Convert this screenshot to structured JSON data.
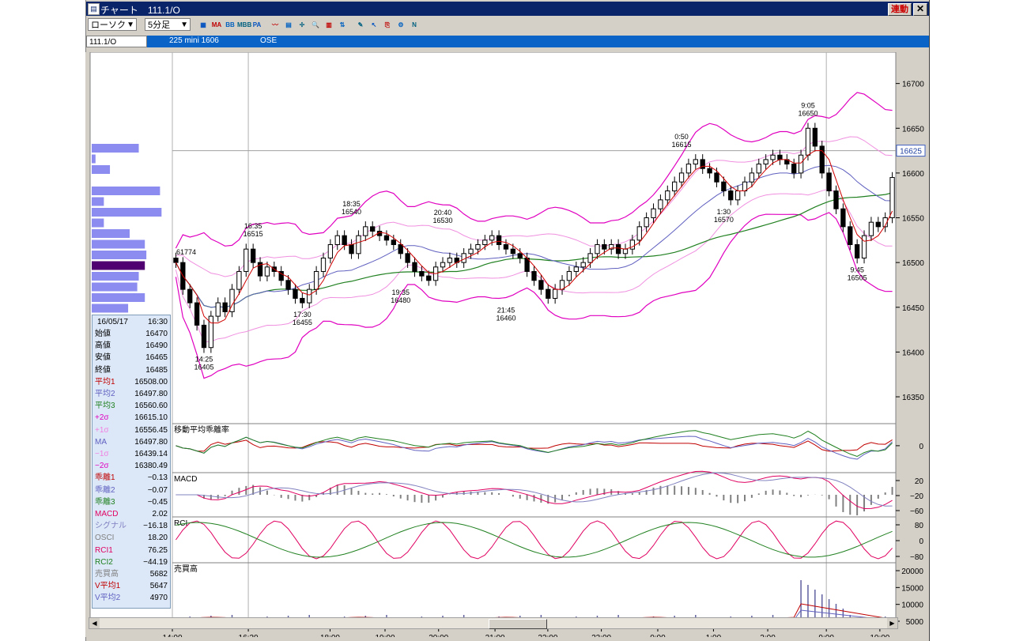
{
  "window": {
    "title": "チャート　111.1/O",
    "link_label": "連動",
    "close_label": "✕"
  },
  "toolbar": {
    "chart_type": "ローソク",
    "interval": "5分足",
    "buttons": [
      {
        "label": "▦",
        "icon": "layout-icon"
      },
      {
        "label": "MA",
        "icon": "ma-icon"
      },
      {
        "label": "BB",
        "icon": "bb-icon"
      },
      {
        "label": "MBB",
        "icon": "mbb-icon"
      },
      {
        "label": "PA",
        "icon": "pa-icon"
      },
      {
        "label": "〰",
        "icon": "line-icon"
      },
      {
        "label": "▤",
        "icon": "grid-icon"
      },
      {
        "label": "✢",
        "icon": "cross-icon"
      },
      {
        "label": "🔍",
        "icon": "zoom-icon"
      },
      {
        "label": "▥",
        "icon": "table-icon"
      },
      {
        "label": "⇅",
        "icon": "swap-icon"
      },
      {
        "label": "✎",
        "icon": "pen-icon"
      },
      {
        "label": "↖",
        "icon": "pointer-icon"
      },
      {
        "label": "⎘",
        "icon": "copy-icon"
      },
      {
        "label": "⚙",
        "icon": "settings-icon"
      },
      {
        "label": "N",
        "icon": "n-icon"
      }
    ]
  },
  "infobar": {
    "code": "111.1/O",
    "name": "225 mini 1606",
    "exchange": "OSE"
  },
  "chart_data": {
    "type": "candlestick",
    "price_axis_ticks": [
      "16700",
      "16650",
      "16600",
      "16550",
      "16500",
      "16450",
      "16400",
      "16350"
    ],
    "ylim": [
      16320,
      16735
    ],
    "current_price_label": "16625",
    "volume_profile_label": "61774",
    "time_labels": [
      "14:00",
      "16:30",
      "18:00",
      "19:00",
      "20:00",
      "21:00",
      "22:00",
      "23:00",
      "0:00",
      "1:00",
      "2:00",
      "9:00",
      "10:00"
    ],
    "annotations": [
      {
        "time": "14:25",
        "price": "16405"
      },
      {
        "time": "16:35",
        "price": "16515"
      },
      {
        "time": "17:30",
        "price": "16455"
      },
      {
        "time": "18:35",
        "price": "16540"
      },
      {
        "time": "19:35",
        "price": "16480"
      },
      {
        "time": "20:40",
        "price": "16530"
      },
      {
        "time": "21:45",
        "price": "16460"
      },
      {
        "time": "0:50",
        "price": "16615"
      },
      {
        "time": "1:30",
        "price": "16570"
      },
      {
        "time": "9:05",
        "price": "16650"
      },
      {
        "time": "9:45",
        "price": "16505"
      }
    ],
    "closes": [
      16500,
      16470,
      16455,
      16430,
      16405,
      16440,
      16455,
      16445,
      16470,
      16490,
      16515,
      16500,
      16485,
      16495,
      16490,
      16480,
      16470,
      16460,
      16455,
      16470,
      16490,
      16505,
      16520,
      16530,
      16520,
      16510,
      16530,
      16540,
      16535,
      16530,
      16525,
      16520,
      16510,
      16500,
      16490,
      16485,
      16480,
      16495,
      16500,
      16505,
      16500,
      16510,
      16515,
      16520,
      16525,
      16530,
      16520,
      16515,
      16510,
      16505,
      16490,
      16480,
      16470,
      16460,
      16470,
      16480,
      16490,
      16495,
      16500,
      16510,
      16520,
      16515,
      16520,
      16510,
      16515,
      16525,
      16540,
      16550,
      16560,
      16570,
      16580,
      16590,
      16600,
      16610,
      16615,
      16605,
      16600,
      16590,
      16580,
      16570,
      16580,
      16590,
      16600,
      16610,
      16615,
      16620,
      16615,
      16610,
      16600,
      16620,
      16650,
      16630,
      16600,
      16580,
      16560,
      16540,
      16520,
      16505,
      16530,
      16545,
      16540,
      16550,
      16595
    ]
  },
  "subcharts": [
    {
      "label": "移動平均乖離率",
      "ticks": [
        "0"
      ]
    },
    {
      "label": "MACD",
      "ticks": [
        "20",
        "−20",
        "−60"
      ]
    },
    {
      "label": "RCI",
      "ticks": [
        "80",
        "0",
        "−80"
      ]
    },
    {
      "label": "売買高",
      "ticks": [
        "20000",
        "15000",
        "10000",
        "5000"
      ]
    }
  ],
  "datapanel": {
    "date": "16/05/17",
    "time": "16:30",
    "rows": [
      {
        "k": "始値",
        "v": "16470",
        "c": "#000"
      },
      {
        "k": "高値",
        "v": "16490",
        "c": "#000"
      },
      {
        "k": "安値",
        "v": "16465",
        "c": "#000"
      },
      {
        "k": "終値",
        "v": "16485",
        "c": "#000"
      },
      {
        "k": "平均1",
        "v": "16508.00",
        "c": "#c00000"
      },
      {
        "k": "平均2",
        "v": "16497.80",
        "c": "#6060c0"
      },
      {
        "k": "平均3",
        "v": "16560.60",
        "c": "#208020"
      },
      {
        "k": "+2σ",
        "v": "16615.10",
        "c": "#e000c0"
      },
      {
        "k": "+1σ",
        "v": "16556.45",
        "c": "#f080e0"
      },
      {
        "k": "MA",
        "v": "16497.80",
        "c": "#6060c0"
      },
      {
        "k": "−1σ",
        "v": "16439.14",
        "c": "#f080e0"
      },
      {
        "k": "−2σ",
        "v": "16380.49",
        "c": "#e000c0"
      },
      {
        "k": "乖離1",
        "v": "−0.13",
        "c": "#c00000"
      },
      {
        "k": "乖離2",
        "v": "−0.07",
        "c": "#6060c0"
      },
      {
        "k": "乖離3",
        "v": "−0.45",
        "c": "#208020"
      },
      {
        "k": "MACD",
        "v": "2.02",
        "c": "#e00060"
      },
      {
        "k": "シグナル",
        "v": "−16.18",
        "c": "#8080c0"
      },
      {
        "k": "OSCI",
        "v": "18.20",
        "c": "#808080"
      },
      {
        "k": "RCI1",
        "v": "76.25",
        "c": "#e00060"
      },
      {
        "k": "RCI2",
        "v": "−44.19",
        "c": "#208020"
      },
      {
        "k": "売買高",
        "v": "5682",
        "c": "#808080"
      },
      {
        "k": "V平均1",
        "v": "5647",
        "c": "#c00000"
      },
      {
        "k": "V平均2",
        "v": "4970",
        "c": "#6060c0"
      }
    ]
  }
}
